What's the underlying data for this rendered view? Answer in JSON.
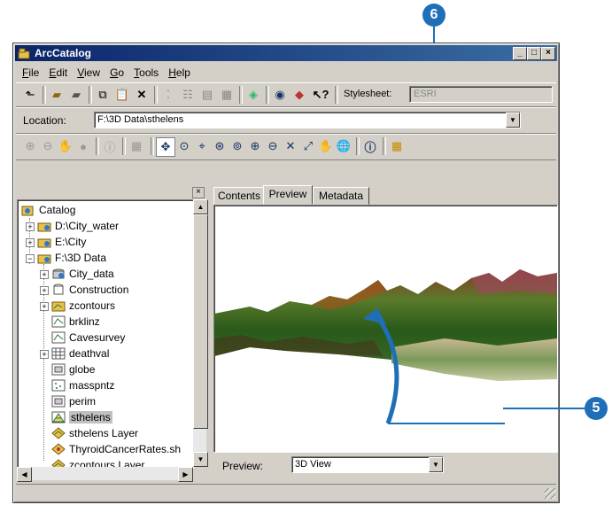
{
  "window": {
    "title": "ArcCatalog"
  },
  "menu": [
    "File",
    "Edit",
    "View",
    "Go",
    "Tools",
    "Help"
  ],
  "stylesheet": {
    "label": "Stylesheet:",
    "value": "ESRI"
  },
  "location": {
    "label": "Location:",
    "value": "F:\\3D Data\\sthelens"
  },
  "catalog": {
    "items": [
      {
        "label": "Catalog"
      },
      {
        "label": "D:\\City_water"
      },
      {
        "label": "E:\\City"
      },
      {
        "label": "F:\\3D Data"
      },
      {
        "label": "City_data"
      },
      {
        "label": "Construction"
      },
      {
        "label": "zcontours"
      },
      {
        "label": "brklinz"
      },
      {
        "label": "Cavesurvey"
      },
      {
        "label": "deathval"
      },
      {
        "label": "globe"
      },
      {
        "label": "masspntz"
      },
      {
        "label": "perim"
      },
      {
        "label": "sthelens"
      },
      {
        "label": "sthelens Layer"
      },
      {
        "label": "ThyroidCancerRates.sh"
      },
      {
        "label": "zcontours Layer"
      }
    ]
  },
  "tabs": [
    "Contents",
    "Preview",
    "Metadata"
  ],
  "preview": {
    "label": "Preview:",
    "value": "3D View"
  },
  "callouts": {
    "five": "5",
    "six": "6"
  },
  "colors": {
    "callout": "#1e6fb8",
    "titlebar": "#0a246a",
    "selection": "#c0c0c0"
  }
}
